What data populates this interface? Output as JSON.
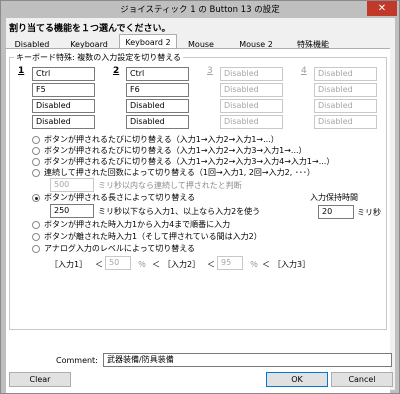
{
  "window": {
    "title": "ジョイスティック 1 の Button 13 の設定",
    "close_glyph": "✕"
  },
  "instruction": "割り当てる機能を１つ選んでください。",
  "tabs": [
    {
      "label": "Disabled"
    },
    {
      "label": "Keyboard"
    },
    {
      "label": "Keyboard 2"
    },
    {
      "label": "Mouse"
    },
    {
      "label": "Mouse 2"
    },
    {
      "label": "特殊機能"
    }
  ],
  "group": {
    "legend": "キーボード特殊: 複数の入力設定を切り替える",
    "columns": [
      {
        "number": "1",
        "enabled": true,
        "fields": [
          "Ctrl",
          "F5",
          "Disabled",
          "Disabled"
        ]
      },
      {
        "number": "2",
        "enabled": true,
        "fields": [
          "Ctrl",
          "F6",
          "Disabled",
          "Disabled"
        ]
      },
      {
        "number": "3",
        "enabled": false,
        "fields": [
          "Disabled",
          "Disabled",
          "Disabled",
          "Disabled"
        ]
      },
      {
        "number": "4",
        "enabled": false,
        "fields": [
          "Disabled",
          "Disabled",
          "Disabled",
          "Disabled"
        ]
      }
    ],
    "options": {
      "cycle2": "ボタンが押されるたびに切り替える（入力1→入力2→入力1→...）",
      "cycle3": "ボタンが押されるたびに切り替える（入力1→入力2→入力3→入力1→...）",
      "cycle4": "ボタンが押されるたびに切り替える（入力1→入力2→入力3→入力4→入力1→...）",
      "count": "連続して押された回数によって切り替える（1回→入力1, 2回→入力2, ･･･）",
      "count_ms_value": "500",
      "count_ms_label": "ミリ秒以内なら連続して押されたと判断",
      "length": "ボタンが押される長さによって切り替える",
      "length_ms_value": "250",
      "length_ms_label": "ミリ秒以下なら入力1、以上なら入力2を使う",
      "hold_label": "入力保持時間",
      "hold_value": "20",
      "hold_unit": "ミリ秒",
      "pressed": "ボタンが押された時入力1から入力4まで順番に入力",
      "released": "ボタンが離された時入力1（そして押されている間は入力2）",
      "analog": "アナログ入力のレベルによって切り替える",
      "analog_in1": "［入力1］",
      "analog_lt1": "＜",
      "analog_val1": "50",
      "analog_pct1": "％",
      "analog_lt2": "＜",
      "analog_in2": "［入力2］",
      "analog_lt3": "＜",
      "analog_val2": "95",
      "analog_pct2": "％",
      "analog_lt4": "＜",
      "analog_in3": "［入力3］"
    }
  },
  "comment": {
    "label": "Comment:",
    "value": "武器装備/防具装備"
  },
  "buttons": {
    "clear": "Clear",
    "ok": "OK",
    "cancel": "Cancel"
  }
}
